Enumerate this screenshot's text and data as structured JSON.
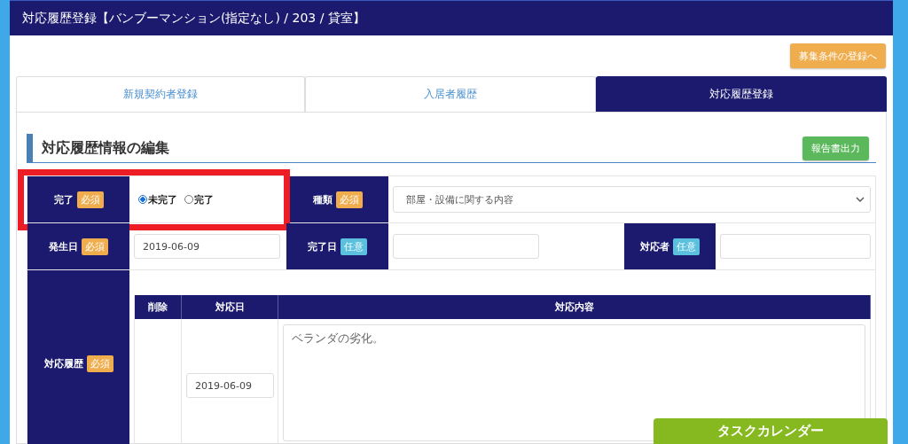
{
  "header": {
    "title": "対応履歴登録【バンブーマンション(指定なし) / 203 / 貸室】"
  },
  "recruit_button": "募集条件の登録へ",
  "tabs": [
    {
      "label": "新規契約者登録",
      "selected": false
    },
    {
      "label": "入居者履歴",
      "selected": false
    },
    {
      "label": "対応履歴登録",
      "selected": true
    }
  ],
  "section": {
    "title": "対応履歴情報の編集",
    "report_button": "報告書出力"
  },
  "form": {
    "completion": {
      "label": "完了",
      "badge": {
        "text": "必須",
        "kind": "required"
      },
      "highlighted": true,
      "options": [
        {
          "label": "未完了",
          "selected": true
        },
        {
          "label": "完了",
          "selected": false
        }
      ]
    },
    "category": {
      "label": "種類",
      "badge": {
        "text": "必須",
        "kind": "required"
      },
      "value": "部屋・設備に関する内容"
    },
    "occurred": {
      "label": "発生日",
      "badge": {
        "text": "必須",
        "kind": "required"
      },
      "value": "2019-06-09"
    },
    "completed": {
      "label": "完了日",
      "badge": {
        "text": "任意",
        "kind": "optional"
      }
    },
    "handler": {
      "label": "対応者",
      "badge": {
        "text": "任意",
        "kind": "optional"
      }
    },
    "history": {
      "label": "対応履歴",
      "badge": {
        "text": "必須",
        "kind": "required"
      },
      "columns": [
        "削除",
        "対応日",
        "対応内容"
      ],
      "rows": [
        {
          "date": "2019-06-09",
          "content": "ベランダの劣化。"
        }
      ]
    }
  },
  "task_calendar_button": "タスクカレンダー"
}
